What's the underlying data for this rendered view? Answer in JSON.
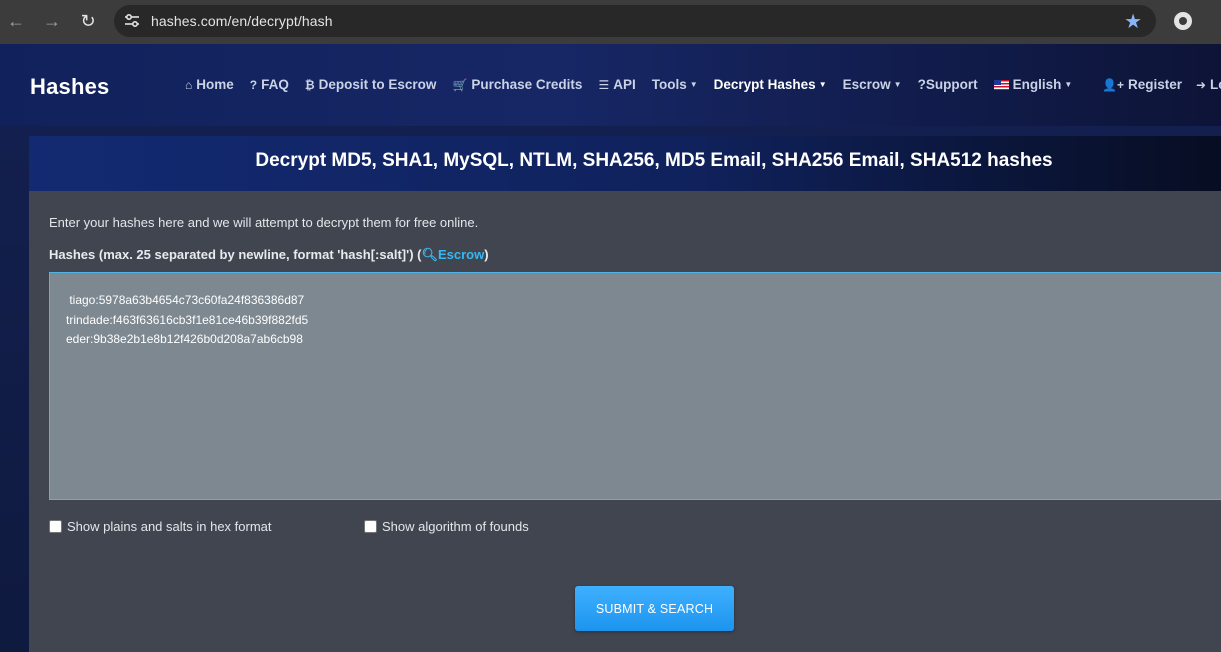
{
  "browser": {
    "url": "hashes.com/en/decrypt/hash",
    "back_icon": "←",
    "forward_icon": "→",
    "reload_icon": "↻",
    "bookmark_icon": "★"
  },
  "navbar": {
    "brand": "Hashes",
    "items": [
      {
        "icon": "home-icon",
        "glyph": "⌂",
        "label": "Home",
        "caret": false
      },
      {
        "icon": "question-icon",
        "glyph": "?",
        "label": "FAQ",
        "caret": false
      },
      {
        "icon": "bitcoin-icon",
        "glyph": "₿",
        "label": "Deposit to Escrow",
        "caret": false
      },
      {
        "icon": "cart-icon",
        "glyph": "🛒",
        "label": "Purchase Credits",
        "caret": false
      },
      {
        "icon": "api-icon",
        "glyph": "☰",
        "label": "API",
        "caret": false
      },
      {
        "icon": "",
        "glyph": "",
        "label": "Tools",
        "caret": true
      },
      {
        "icon": "",
        "glyph": "",
        "label": "Decrypt Hashes",
        "caret": true,
        "active": true
      },
      {
        "icon": "",
        "glyph": "",
        "label": "Escrow",
        "caret": true
      },
      {
        "icon": "",
        "glyph": "",
        "label": "?Support",
        "caret": false
      },
      {
        "icon": "flag-icon",
        "glyph": "",
        "label": "English",
        "caret": true
      }
    ],
    "register_label": "Register",
    "login_label": "Log"
  },
  "card": {
    "title": "Decrypt MD5, SHA1, MySQL, NTLM, SHA256, MD5 Email, SHA256 Email, SHA512 hashes",
    "intro": "Enter your hashes here and we will attempt to decrypt them for free online.",
    "field_label": "Hashes (max. 25 separated by newline, format 'hash[:salt]') (",
    "escrow_link": "Escrow",
    "field_label_end": ")",
    "hashes_value": " tiago:5978a63b4654c73c60fa24f836386d87\ntrindade:f463f63616cb3f1e81ce46b39f882fd5\neder:9b38e2b1e8b12f426b0d208a7ab6cb98",
    "option_hex": "Show plains and salts in hex format",
    "option_algorithm": "Show algorithm of founds",
    "submit_label": "SUBMIT & SEARCH"
  },
  "colors": {
    "accent": "#1c94ee",
    "link": "#37b8f0",
    "card_bg": "#404550",
    "textarea_bg": "#7d8891"
  }
}
